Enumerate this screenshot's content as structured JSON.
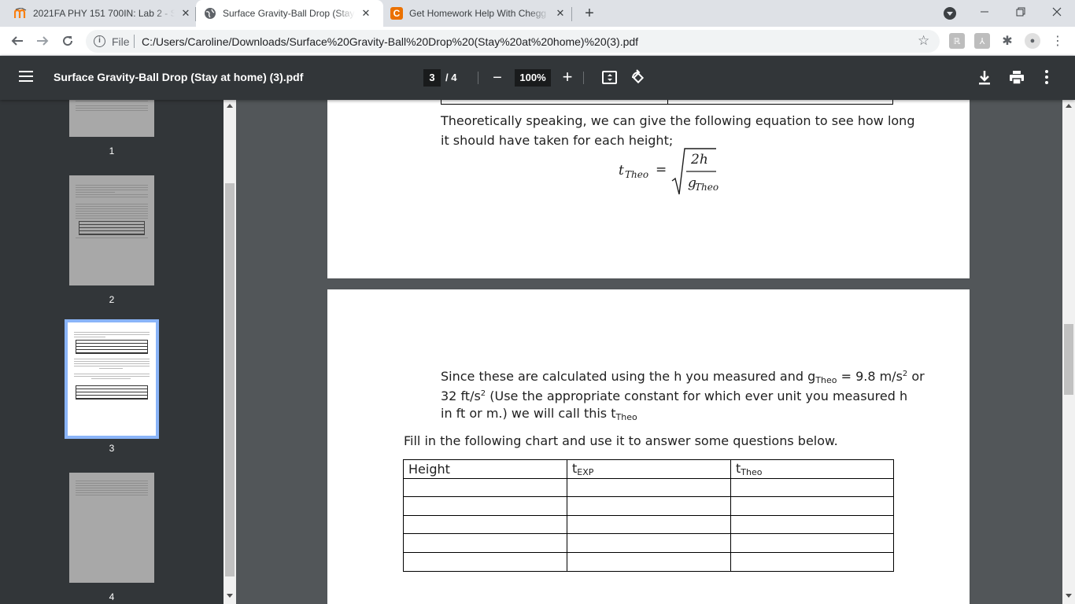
{
  "browser": {
    "tabs": [
      {
        "title": "2021FA PHY 151 700IN: Lab 2 - S",
        "favicon": "moodle-icon",
        "active": false
      },
      {
        "title": "Surface Gravity-Ball Drop (Stay at",
        "favicon": "globe-icon",
        "active": true
      },
      {
        "title": "Get Homework Help With Chegg",
        "favicon": "chegg-icon",
        "active": false
      }
    ],
    "close_glyph": "✕",
    "new_tab_glyph": "+",
    "file_label": "File",
    "url": "C:/Users/Caroline/Downloads/Surface%20Gravity-Ball%20Drop%20(Stay%20at%20home)%20(3).pdf",
    "colors": {
      "tabstrip": "#dee1e6",
      "pdf_toolbar": "#323639",
      "chegg": "#eb7100"
    }
  },
  "pdf_viewer": {
    "title": "Surface Gravity-Ball Drop (Stay at home) (3).pdf",
    "current_page": "3",
    "page_total": "/ 4",
    "zoom": "100%"
  },
  "thumbnails": [
    {
      "number": "1"
    },
    {
      "number": "2"
    },
    {
      "number": "3",
      "selected": true
    },
    {
      "number": "4"
    }
  ],
  "page3": {
    "paragraph_line1": "Theoretically speaking, we can give the following equation to see how long",
    "paragraph_line2": "it should have taken for each height;",
    "equation": {
      "lhs": "t",
      "lhs_sub": "Theo",
      "equals": "=",
      "numerator": "2h",
      "denominator": "g",
      "denominator_sub": "Theo"
    }
  },
  "page4": {
    "line1_a": "Since these are calculated using the h you measured and g",
    "line1_sub": "Theo",
    "line1_b": " = 9.8 m/s",
    "line1_sup": "2",
    "line1_c": " or",
    "line2_a": "32 ft/s",
    "line2_sup": "2",
    "line2_b": " (Use the appropriate constant for which ever unit you measured h",
    "line3_a": "in ft or m.) we will call this t",
    "line3_sub": "Theo",
    "instruction": "Fill in the following chart and use it to answer some questions below.",
    "table": {
      "headers": [
        {
          "main": "Height",
          "sub": ""
        },
        {
          "main": "t",
          "sub": "EXP"
        },
        {
          "main": "t",
          "sub": "Theo"
        }
      ],
      "empty_rows": 5
    }
  }
}
